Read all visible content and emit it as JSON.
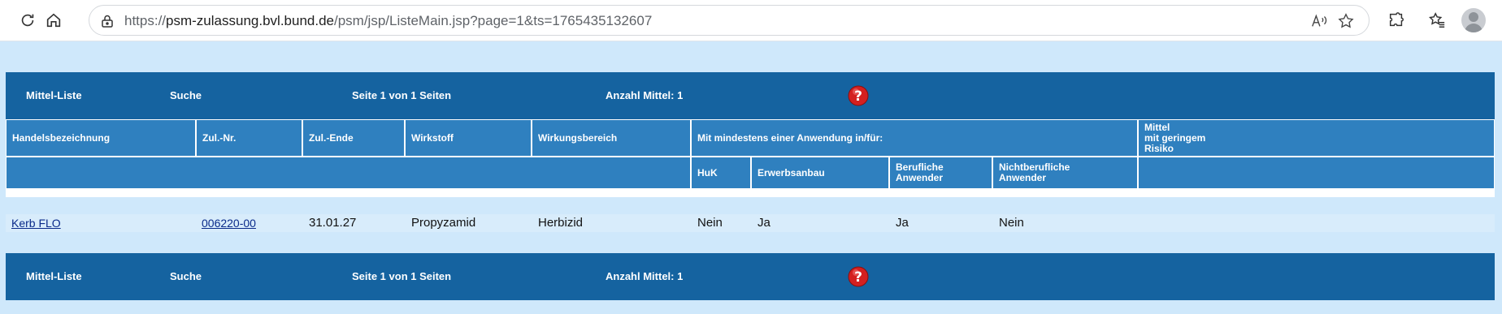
{
  "browser": {
    "url_prefix": "https://",
    "url_host": "psm-zulassung.bvl.bund.de",
    "url_path": "/psm/jsp/ListeMain.jsp?page=1&ts=1765435132607"
  },
  "nav": {
    "mittel_liste": "Mittel-Liste",
    "suche": "Suche",
    "seite": "Seite 1 von 1 Seiten",
    "anzahl": "Anzahl Mittel: 1"
  },
  "table": {
    "headers": {
      "handelsbezeichnung": "Handelsbezeichnung",
      "zulnr": "Zul.-Nr.",
      "zulende": "Zul.-Ende",
      "wirkstoff": "Wirkstoff",
      "wirkungsbereich": "Wirkungsbereich",
      "anwendung": "Mit mindestens einer Anwendung in/für:",
      "risiko_l1": "Mittel",
      "risiko_l2": "mit geringem",
      "risiko_l3": "Risiko",
      "huk": "HuK",
      "erwerbsanbau": "Erwerbsanbau",
      "beruflich_l1": "Berufliche",
      "beruflich_l2": "Anwender",
      "nichtberuflich_l1": "Nichtberufliche",
      "nichtberuflich_l2": "Anwender"
    },
    "rows": [
      {
        "handelsbezeichnung": "Kerb FLO",
        "zulnr": "006220-00",
        "zulende": "31.01.27",
        "wirkstoff": "Propyzamid",
        "wirkungsbereich": "Herbizid",
        "huk": "Nein",
        "erwerbsanbau": "Ja",
        "beruflich": "Ja",
        "nichtberuflich": "Nein",
        "risiko": ""
      }
    ]
  },
  "colors": {
    "nav_bg": "#1563a0",
    "header_bg": "#2f80bf",
    "page_bg": "#cfe8fb",
    "row_bg": "#d8ecfb",
    "help_red": "#d42020"
  }
}
